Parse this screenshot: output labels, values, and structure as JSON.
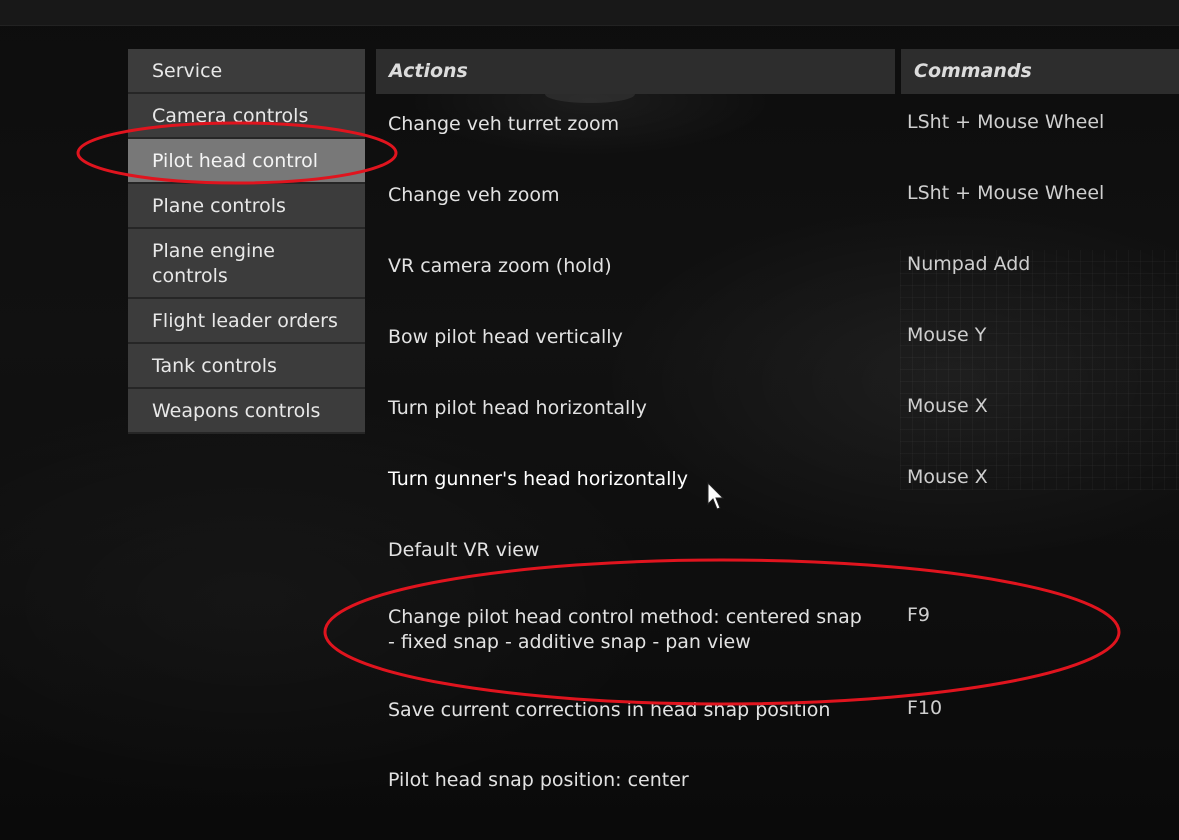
{
  "sidebar": {
    "items": [
      {
        "label": "Service"
      },
      {
        "label": "Camera controls"
      },
      {
        "label": "Pilot head control"
      },
      {
        "label": "Plane controls"
      },
      {
        "label": "Plane engine controls"
      },
      {
        "label": "Flight leader orders"
      },
      {
        "label": "Tank controls"
      },
      {
        "label": "Weapons controls"
      }
    ],
    "active": "Pilot head control"
  },
  "table": {
    "headers": {
      "actions": "Actions",
      "commands": "Commands"
    },
    "rows": [
      {
        "action": "Change veh turret zoom",
        "command": "LSht + Mouse Wheel"
      },
      {
        "action": "Change veh zoom",
        "command": "LSht + Mouse Wheel"
      },
      {
        "action": "VR camera zoom (hold)",
        "command": "Numpad Add"
      },
      {
        "action": "Bow pilot head vertically",
        "command": "Mouse Y"
      },
      {
        "action": "Turn pilot head horizontally",
        "command": "Mouse X"
      },
      {
        "action": "Turn gunner's head horizontally",
        "command": "Mouse X"
      },
      {
        "action": "Default VR view",
        "command": ""
      },
      {
        "action": "Change pilot head control method: centered snap - fixed snap - additive snap - pan view",
        "command": "F9"
      },
      {
        "action": "Save current corrections in head snap position",
        "command": "F10"
      },
      {
        "action": "Pilot head snap position: center",
        "command": ""
      }
    ]
  },
  "annotations": {
    "color": "#e0141e"
  },
  "colors": {
    "background": "#0b0b0b",
    "sidebar_item": "#3c3c3c",
    "sidebar_active": "#787878",
    "header": "#2d2d2d",
    "text": "#e2e2e2"
  }
}
